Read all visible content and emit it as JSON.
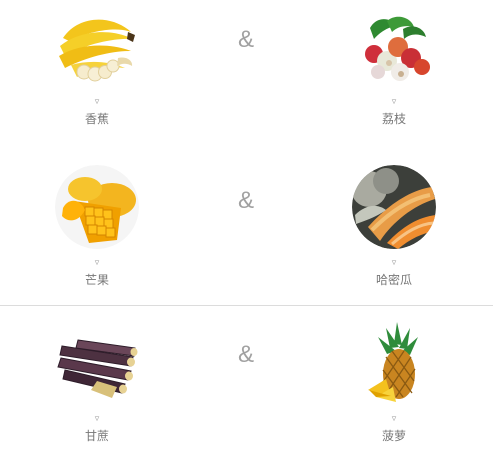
{
  "pairs": [
    {
      "left": {
        "name": "香蕉",
        "arrow": "▿",
        "icon": "banana-image"
      },
      "connector": "&",
      "right": {
        "name": "荔枝",
        "arrow": "▿",
        "icon": "lychee-image"
      }
    },
    {
      "left": {
        "name": "芒果",
        "arrow": "▿",
        "icon": "mango-image"
      },
      "connector": "&",
      "right": {
        "name": "哈密瓜",
        "arrow": "▿",
        "icon": "cantaloupe-image"
      }
    },
    {
      "left": {
        "name": "甘蔗",
        "arrow": "▿",
        "icon": "sugarcane-image"
      },
      "connector": "&",
      "right": {
        "name": "菠萝",
        "arrow": "▿",
        "icon": "pineapple-image"
      }
    }
  ],
  "colors": {
    "background": "#ffffff",
    "text": "#777777",
    "connector": "#a1a1a1",
    "divider": "#dcdcdc"
  }
}
